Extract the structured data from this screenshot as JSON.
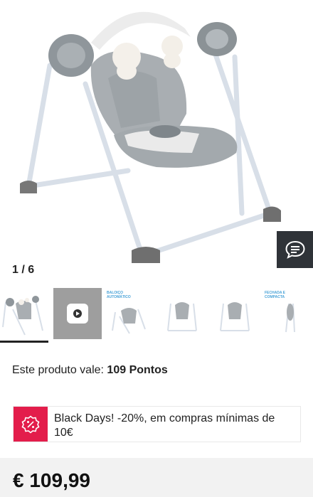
{
  "gallery": {
    "counter": "1 / 6",
    "thumbnails": [
      {
        "kind": "photo",
        "tag": ""
      },
      {
        "kind": "video",
        "tag": ""
      },
      {
        "kind": "infographic",
        "tag": "BALOIÇO AUTOMÁTICO"
      },
      {
        "kind": "infographic",
        "tag": ""
      },
      {
        "kind": "infographic",
        "tag": ""
      },
      {
        "kind": "infographic",
        "tag": "FECHADA E COMPACTA"
      }
    ]
  },
  "points": {
    "prefix": "Este produto vale:",
    "value": "109 Pontos"
  },
  "promo": {
    "text": "Black Days! -20%, em compras mínimas de 10€",
    "icon": "percent-badge-icon"
  },
  "price": {
    "value": "€ 109,99"
  },
  "colors": {
    "promo_badge": "#e31d4b",
    "chat_button": "#2f3338",
    "frame": "#d6dde6",
    "seat": "#9aa1a6"
  }
}
